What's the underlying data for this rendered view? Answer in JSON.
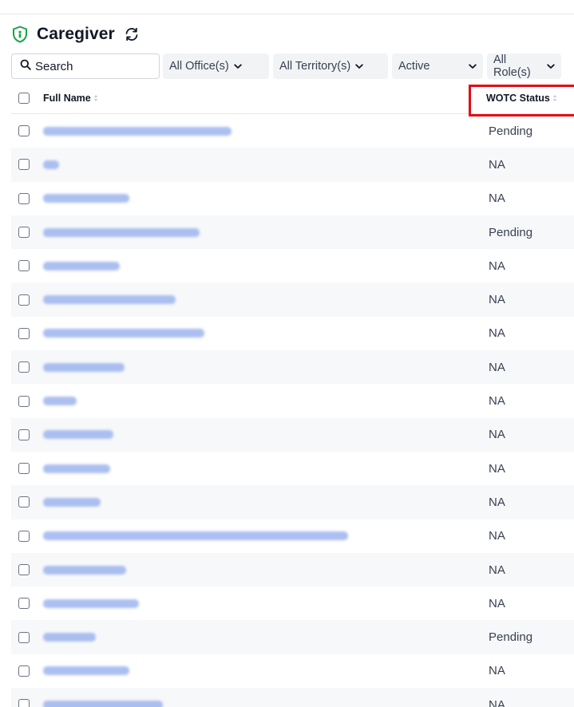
{
  "header": {
    "title": "Caregiver"
  },
  "filters": {
    "search_label": "Search",
    "office": "All Office(s)",
    "territory": "All Territory(s)",
    "active": "Active",
    "role": "All Role(s)"
  },
  "table": {
    "columns": {
      "name": "Full Name",
      "status": "WOTC Status"
    },
    "rows": [
      {
        "status": "Pending"
      },
      {
        "status": "NA"
      },
      {
        "status": "NA"
      },
      {
        "status": "Pending"
      },
      {
        "status": "NA"
      },
      {
        "status": "NA"
      },
      {
        "status": "NA"
      },
      {
        "status": "NA"
      },
      {
        "status": "NA"
      },
      {
        "status": "NA"
      },
      {
        "status": "NA"
      },
      {
        "status": "NA"
      },
      {
        "status": "NA"
      },
      {
        "status": "NA"
      },
      {
        "status": "NA"
      },
      {
        "status": "Pending"
      },
      {
        "status": "NA"
      },
      {
        "status": "NA"
      }
    ]
  },
  "colors": {
    "accent": "#16a34a",
    "highlight": "#e50914",
    "link_blur": "#9db4ee"
  }
}
